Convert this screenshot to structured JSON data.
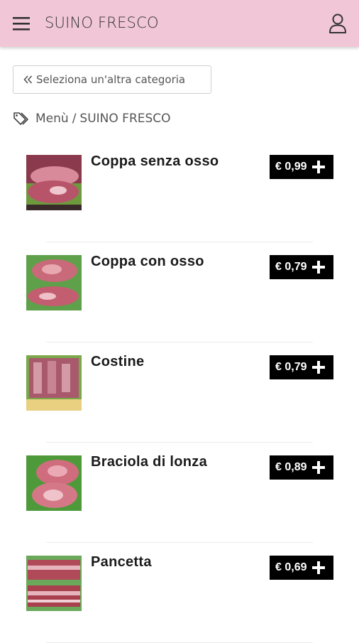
{
  "header": {
    "title": "SUINO FRESCO",
    "menu_icon": "hamburger-icon",
    "user_icon": "user-icon",
    "background": "#f1c6d6"
  },
  "back_button": {
    "label": "Seleziona un'altra categoria",
    "icon": "double-chevron-left-icon"
  },
  "breadcrumb": {
    "icon": "tags-icon",
    "items": [
      "Menù",
      "SUINO FRESCO"
    ],
    "separator": "/"
  },
  "products": [
    {
      "name": "Coppa senza osso",
      "price": "€ 0,99",
      "thumb_colors": [
        "#b8546a",
        "#d8899a",
        "#6c9a3c"
      ]
    },
    {
      "name": "Coppa con osso",
      "price": "€ 0,79",
      "thumb_colors": [
        "#c96a7a",
        "#e8a8b0",
        "#5fa04a"
      ]
    },
    {
      "name": "Costine",
      "price": "€ 0,79",
      "thumb_colors": [
        "#a85a6c",
        "#d49aa8",
        "#7aa84a"
      ]
    },
    {
      "name": "Braciola di lonza",
      "price": "€ 0,89",
      "thumb_colors": [
        "#cf6d7e",
        "#eaa9b4",
        "#4e9a3a"
      ]
    },
    {
      "name": "Pancetta",
      "price": "€ 0,69",
      "thumb_colors": [
        "#b04a58",
        "#e6b4bc",
        "#6aa85a"
      ]
    }
  ],
  "colors": {
    "accent": "#000000",
    "price_text": "#ffffff"
  }
}
